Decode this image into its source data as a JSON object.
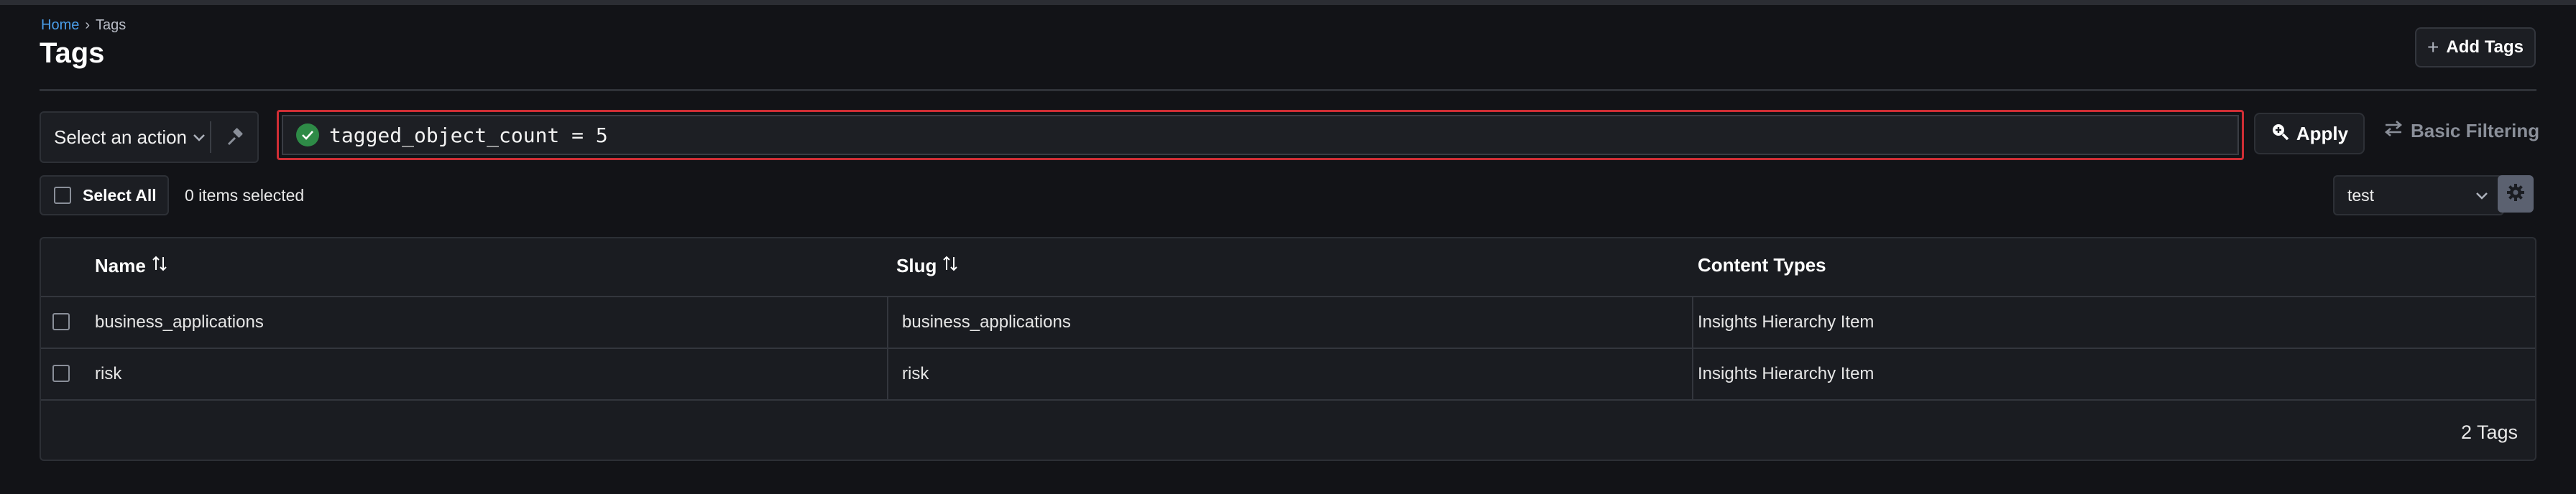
{
  "breadcrumb": {
    "home": "Home",
    "separator": "›",
    "current": "Tags"
  },
  "page": {
    "title": "Tags"
  },
  "header": {
    "add_button": "Add Tags"
  },
  "toolbar": {
    "action_select": "Select an action",
    "filter_query": "tagged_object_count = 5",
    "apply": "Apply",
    "basic_filtering": "Basic Filtering"
  },
  "selection": {
    "select_all": "Select All",
    "count_text": "0 items selected"
  },
  "view": {
    "selected": "test"
  },
  "table": {
    "columns": [
      "Name",
      "Slug",
      "Content Types"
    ],
    "rows": [
      {
        "name": "business_applications",
        "slug": "business_applications",
        "content_types": "Insights Hierarchy Item"
      },
      {
        "name": "risk",
        "slug": "risk",
        "content_types": "Insights Hierarchy Item"
      }
    ],
    "footer": "2 Tags"
  },
  "icons": {
    "breadcrumb_sep": "chevron-right-icon",
    "add": "plus-icon",
    "action_dropdown": "chevron-down-icon",
    "pin": "hammer-icon",
    "filter_valid": "check-circle-icon",
    "apply": "search-plus-icon",
    "basic_filtering": "swap-arrows-icon",
    "view_dropdown": "chevron-down-icon",
    "settings": "gear-icon",
    "sort": "sort-arrows-icon"
  },
  "colors": {
    "background": "#121317",
    "link": "#4a9eea",
    "filter_border": "#cf2e35",
    "valid_badge": "#2e8b47",
    "gear_button": "#5b6170"
  }
}
